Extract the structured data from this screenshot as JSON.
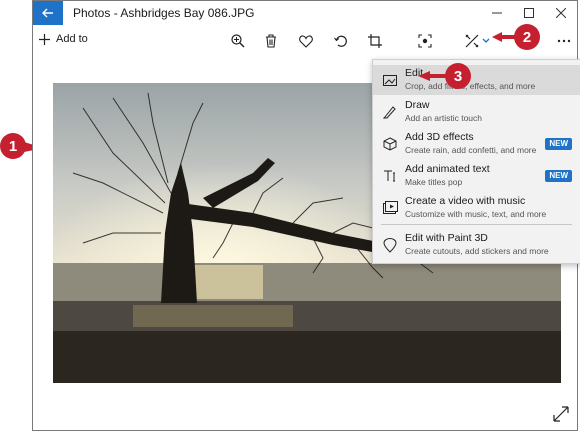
{
  "window": {
    "title": "Photos - Ashbridges Bay 086.JPG",
    "accent": "#1e73c8"
  },
  "toolbar": {
    "add_to_label": "Add to",
    "icons": [
      "zoom-icon",
      "delete-icon",
      "favorite-icon",
      "rotate-icon",
      "crop-icon",
      "enhance-icon",
      "edit-create-icon",
      "chevron-down-icon",
      "more-icon"
    ]
  },
  "menu": {
    "items": [
      {
        "title": "Edit",
        "desc": "Crop, add filters, effects, and more",
        "icon": "edit-photo-icon",
        "badge": ""
      },
      {
        "title": "Draw",
        "desc": "Add an artistic touch",
        "icon": "pen-icon",
        "badge": ""
      },
      {
        "title": "Add 3D effects",
        "desc": "Create rain, add confetti, and more",
        "icon": "3d-cube-icon",
        "badge": "NEW"
      },
      {
        "title": "Add animated text",
        "desc": "Make titles pop",
        "icon": "text-icon",
        "badge": "NEW"
      },
      {
        "title": "Create a video with music",
        "desc": "Customize with music, text, and more",
        "icon": "video-icon",
        "badge": ""
      },
      {
        "title": "Edit with Paint 3D",
        "desc": "Create cutouts, add stickers and more",
        "icon": "paint3d-icon",
        "badge": ""
      }
    ]
  },
  "callouts": [
    "1",
    "2",
    "3"
  ],
  "callout_color": "#c5202f"
}
